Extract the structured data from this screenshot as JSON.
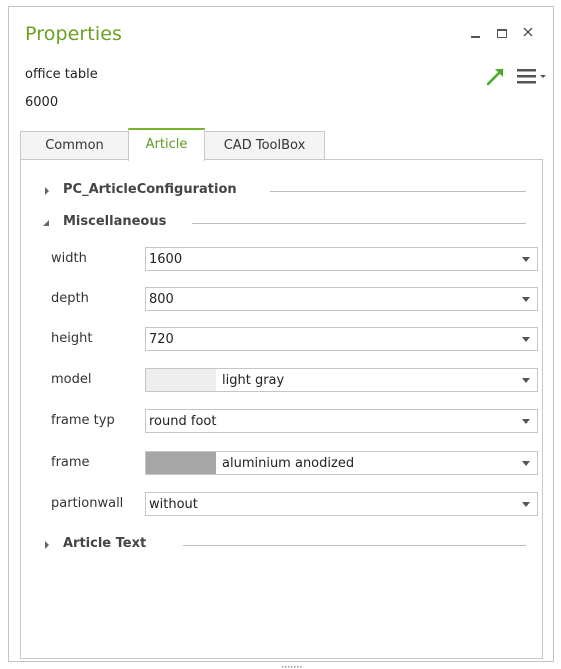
{
  "window": {
    "title": "Properties",
    "controls": [
      "minimize",
      "maximize",
      "close"
    ]
  },
  "header": {
    "object_name": "office table",
    "object_number": "6000",
    "icons": [
      "arrow-up-right-icon",
      "hamburger-menu-icon"
    ]
  },
  "tabs": [
    {
      "label": "Common",
      "active": false
    },
    {
      "label": "Article",
      "active": true
    },
    {
      "label": "CAD ToolBox",
      "active": false
    }
  ],
  "groups": {
    "pc_article_configuration": {
      "label": "PC_ArticleConfiguration",
      "expanded": false
    },
    "miscellaneous": {
      "label": "Miscellaneous",
      "expanded": true
    },
    "article_text": {
      "label": "Article Text",
      "expanded": false
    }
  },
  "properties": [
    {
      "label": "width",
      "value": "1600"
    },
    {
      "label": "depth",
      "value": "800"
    },
    {
      "label": "height",
      "value": "720"
    },
    {
      "label": "model",
      "value": "light gray",
      "swatch": "#eeeeee"
    },
    {
      "label": "frame typ",
      "value": "round foot"
    },
    {
      "label": "frame",
      "value": "aluminium anodized",
      "swatch": "#a6a6a6"
    },
    {
      "label": "partionwall",
      "value": "without"
    }
  ],
  "colors": {
    "accent_green": "#6aa121",
    "tab_active_border": "#78b42c"
  }
}
